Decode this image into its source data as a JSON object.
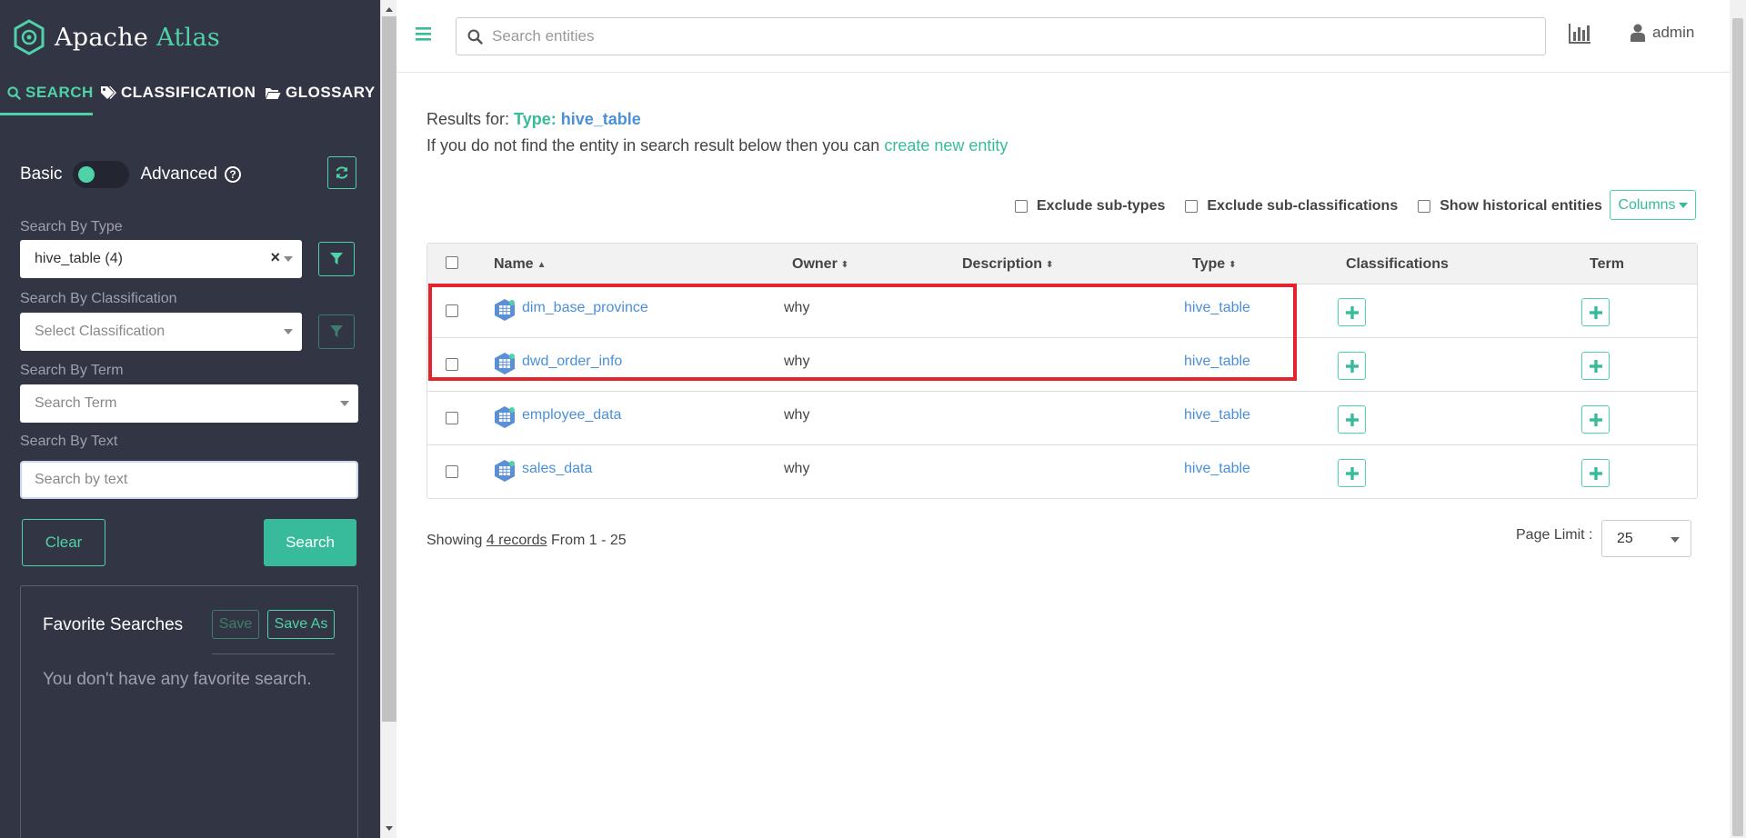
{
  "brand": {
    "name_part1": "Apache",
    "name_part2": "Atlas",
    "accent_color": "#4fd2a7"
  },
  "sidebar": {
    "tabs": [
      {
        "label": "SEARCH",
        "icon": "search-icon",
        "active": true
      },
      {
        "label": "CLASSIFICATION",
        "icon": "tags-icon",
        "active": false
      },
      {
        "label": "GLOSSARY",
        "icon": "folder-open-icon",
        "active": false
      }
    ],
    "mode": {
      "basic_label": "Basic",
      "advanced_label": "Advanced",
      "help_glyph": "?"
    },
    "search_by_type": {
      "label": "Search By Type",
      "value": "hive_table (4)",
      "clear": "×"
    },
    "search_by_classification": {
      "label": "Search By Classification",
      "placeholder": "Select Classification"
    },
    "search_by_term": {
      "label": "Search By Term",
      "placeholder": "Search Term"
    },
    "search_by_text": {
      "label": "Search By Text",
      "placeholder": "Search by text",
      "value": ""
    },
    "buttons": {
      "clear": "Clear",
      "search": "Search"
    },
    "favorites": {
      "title": "Favorite Searches",
      "save": "Save",
      "save_as": "Save As",
      "empty": "You don't have any favorite search."
    }
  },
  "topbar": {
    "search_placeholder": "Search entities",
    "user": "admin"
  },
  "results": {
    "results_for_label": "Results for:",
    "type_label": "Type:",
    "type_value": "hive_table",
    "not_found_text": "If you do not find the entity in search result below then you can",
    "create_link": "create new entity"
  },
  "filters": {
    "exclude_subtypes": "Exclude sub-types",
    "exclude_subclassifications": "Exclude sub-classifications",
    "show_historical": "Show historical entities",
    "columns": "Columns"
  },
  "table": {
    "headers": {
      "name": "Name",
      "owner": "Owner",
      "description": "Description",
      "type": "Type",
      "classifications": "Classifications",
      "term": "Term"
    },
    "rows": [
      {
        "name": "dim_base_province",
        "owner": "why",
        "description": "",
        "type": "hive_table"
      },
      {
        "name": "dwd_order_info",
        "owner": "why",
        "description": "",
        "type": "hive_table"
      },
      {
        "name": "employee_data",
        "owner": "why",
        "description": "",
        "type": "hive_table"
      },
      {
        "name": "sales_data",
        "owner": "why",
        "description": "",
        "type": "hive_table"
      }
    ],
    "highlight_color": "#e3242b"
  },
  "pagination": {
    "showing_prefix": "Showing",
    "records_link": "4 records",
    "range": "From 1 - 25",
    "page_limit_label": "Page Limit :",
    "page_limit_value": "25"
  }
}
